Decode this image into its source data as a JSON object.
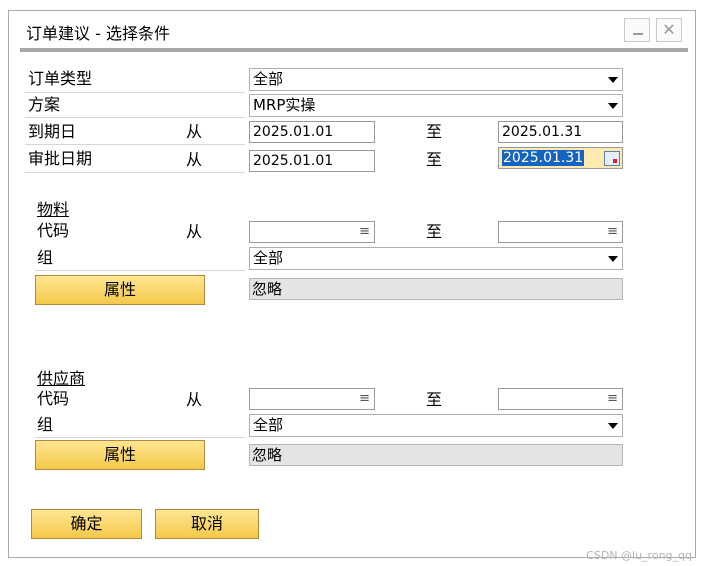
{
  "window": {
    "title": "订单建议 - 选择条件",
    "controls": {
      "minimize": "minimize-icon",
      "close": "close-icon",
      "close_glyph": "✕"
    }
  },
  "form": {
    "order_type": {
      "label": "订单类型",
      "value": "全部"
    },
    "scenario": {
      "label": "方案",
      "value": "MRP实操"
    },
    "due_date": {
      "label": "到期日",
      "from_label": "从",
      "from": "2025.01.01",
      "to_label": "至",
      "to": "2025.01.31"
    },
    "approval_date": {
      "label": "审批日期",
      "from_label": "从",
      "from": "2025.01.01",
      "to_label": "至",
      "to": "2025.01.31"
    }
  },
  "material": {
    "section_label": "物料",
    "code_label": "代码",
    "from_label": "从",
    "to_label": "至",
    "code_from": "",
    "code_to": "",
    "group_label": "组",
    "group_value": "全部",
    "properties_button": "属性",
    "properties_value": "忽略"
  },
  "supplier": {
    "section_label": "供应商",
    "code_label": "代码",
    "from_label": "从",
    "to_label": "至",
    "code_from": "",
    "code_to": "",
    "group_label": "组",
    "group_value": "全部",
    "properties_button": "属性",
    "properties_value": "忽略"
  },
  "buttons": {
    "ok": "确定",
    "cancel": "取消"
  },
  "icons": {
    "dropdown": "chevron-down-icon",
    "list": "list-icon",
    "list_glyph": "≡",
    "calendar": "calendar-icon"
  },
  "watermark": "CSDN @lu_rong_qq",
  "colors": {
    "button_yellow": "#f4c94a",
    "selection_blue": "#1565c0",
    "selected_field_bg": "#ffeab0"
  }
}
